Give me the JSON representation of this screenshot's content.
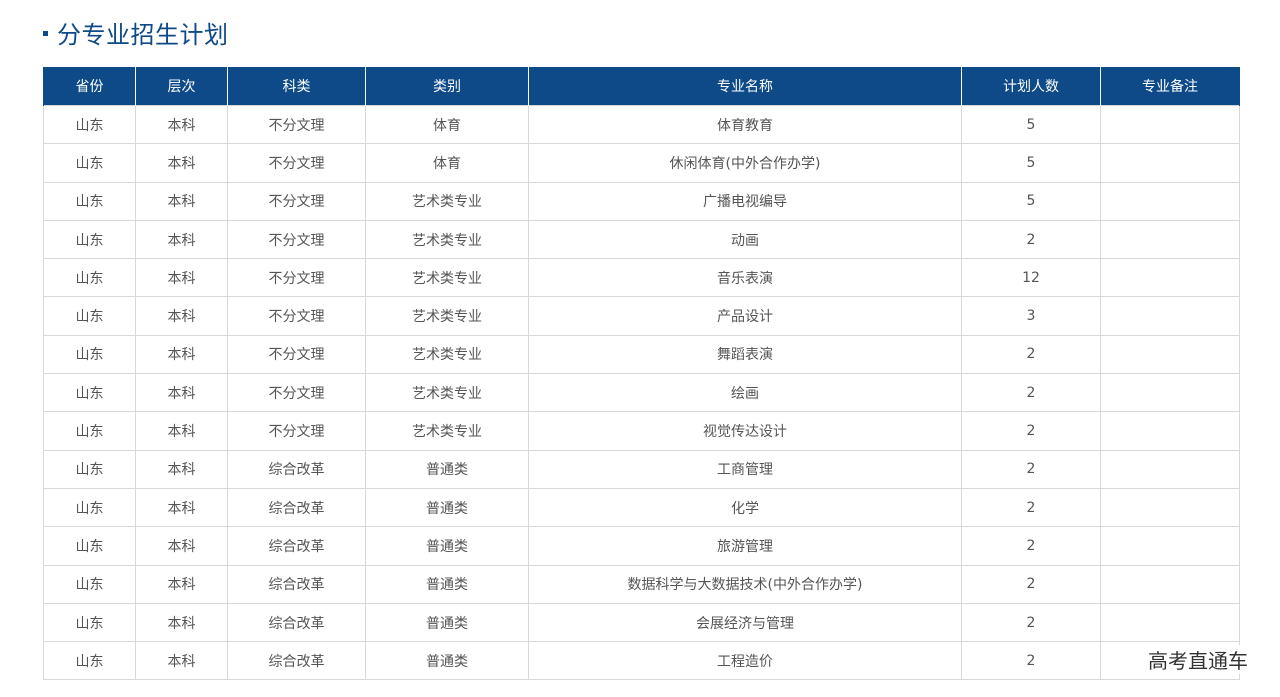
{
  "section": {
    "title": "分专业招生计划"
  },
  "table": {
    "headers": [
      "省份",
      "层次",
      "科类",
      "类别",
      "专业名称",
      "计划人数",
      "专业备注"
    ],
    "rows": [
      [
        "山东",
        "本科",
        "不分文理",
        "体育",
        "体育教育",
        "5",
        ""
      ],
      [
        "山东",
        "本科",
        "不分文理",
        "体育",
        "休闲体育(中外合作办学)",
        "5",
        ""
      ],
      [
        "山东",
        "本科",
        "不分文理",
        "艺术类专业",
        "广播电视编导",
        "5",
        ""
      ],
      [
        "山东",
        "本科",
        "不分文理",
        "艺术类专业",
        "动画",
        "2",
        ""
      ],
      [
        "山东",
        "本科",
        "不分文理",
        "艺术类专业",
        "音乐表演",
        "12",
        ""
      ],
      [
        "山东",
        "本科",
        "不分文理",
        "艺术类专业",
        "产品设计",
        "3",
        ""
      ],
      [
        "山东",
        "本科",
        "不分文理",
        "艺术类专业",
        "舞蹈表演",
        "2",
        ""
      ],
      [
        "山东",
        "本科",
        "不分文理",
        "艺术类专业",
        "绘画",
        "2",
        ""
      ],
      [
        "山东",
        "本科",
        "不分文理",
        "艺术类专业",
        "视觉传达设计",
        "2",
        ""
      ],
      [
        "山东",
        "本科",
        "综合改革",
        "普通类",
        "工商管理",
        "2",
        ""
      ],
      [
        "山东",
        "本科",
        "综合改革",
        "普通类",
        "化学",
        "2",
        ""
      ],
      [
        "山东",
        "本科",
        "综合改革",
        "普通类",
        "旅游管理",
        "2",
        ""
      ],
      [
        "山东",
        "本科",
        "综合改革",
        "普通类",
        "数据科学与大数据技术(中外合作办学)",
        "2",
        ""
      ],
      [
        "山东",
        "本科",
        "综合改革",
        "普通类",
        "会展经济与管理",
        "2",
        ""
      ],
      [
        "山东",
        "本科",
        "综合改革",
        "普通类",
        "工程造价",
        "2",
        ""
      ]
    ]
  },
  "watermark": {
    "text": "高考直通车"
  },
  "colors": {
    "accent": "#0d4a87",
    "cell_text": "#555555",
    "border": "#d9d9d9"
  }
}
